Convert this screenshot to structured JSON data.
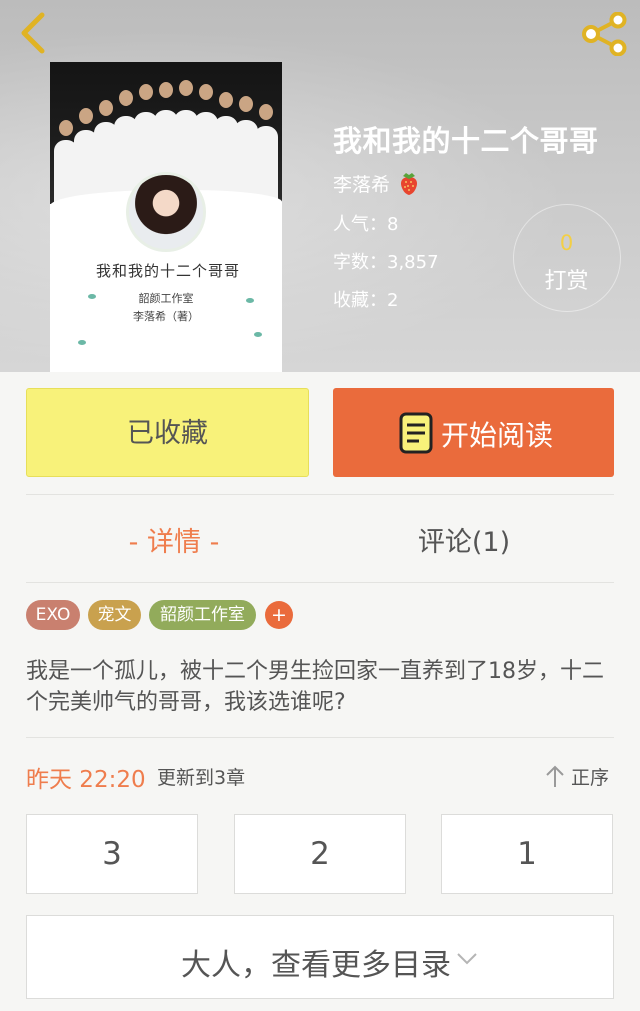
{
  "header": {
    "book_title": "我和我的十二个哥哥",
    "author": "李落希",
    "stats": {
      "popularity": "人气：8",
      "word_count": "字数：3,857",
      "favorites": "收藏：2"
    },
    "reward": {
      "count": "0",
      "label": "打赏"
    },
    "icons": {
      "back": "back-chevron-icon",
      "share": "share-icon",
      "author_badge": "strawberry-icon"
    }
  },
  "cover": {
    "title": "我和我的十二个哥哥",
    "subtitle_1": "韶颜工作室",
    "subtitle_2": "李落希（著）"
  },
  "actions": {
    "favorited_label": "已收藏",
    "start_reading_label": "开始阅读",
    "start_reading_icon": "book-icon"
  },
  "tabs": {
    "detail": "- 详情 -",
    "comments": "评论(1)"
  },
  "tags": {
    "items": [
      "EXO",
      "宠文",
      "韶颜工作室"
    ],
    "add_label": "+"
  },
  "summary": "我是一个孤儿，被十二个男生捡回家一直养到了18岁，十二个完美帅气的哥哥，我该选谁呢?",
  "update": {
    "time": "昨天 22:20",
    "text": "更新到3章",
    "sort_label": "正序",
    "sort_icon": "arrow-up-icon"
  },
  "chapters": [
    "3",
    "2",
    "1"
  ],
  "more_catalog": {
    "label": "大人，查看更多目录",
    "icon": "chevron-down-icon"
  },
  "colors": {
    "accent": "#ea6b3c",
    "favorite_bg": "#f8f27a",
    "tab_active": "#ef7d4d",
    "reward_count": "#f3cf45",
    "tag_1": "#c9806f",
    "tag_2": "#c9a14e",
    "tag_3": "#92ab5b"
  }
}
